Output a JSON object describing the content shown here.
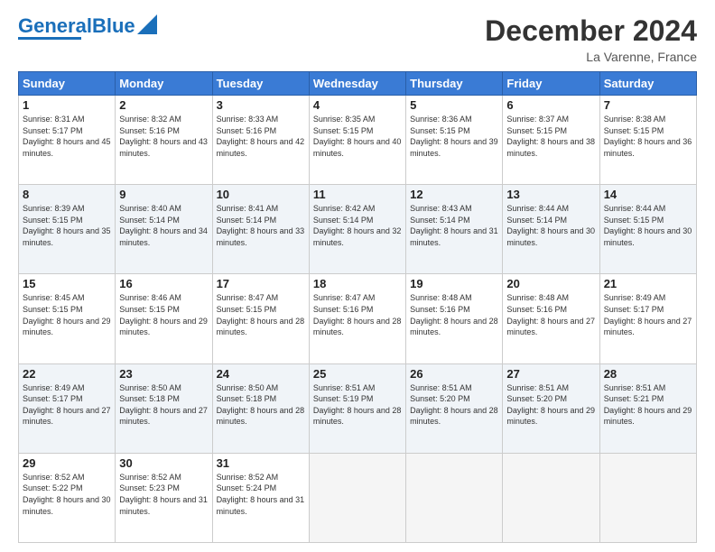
{
  "header": {
    "logo_text1": "General",
    "logo_text2": "Blue",
    "main_title": "December 2024",
    "subtitle": "La Varenne, France"
  },
  "calendar": {
    "days_of_week": [
      "Sunday",
      "Monday",
      "Tuesday",
      "Wednesday",
      "Thursday",
      "Friday",
      "Saturday"
    ],
    "weeks": [
      [
        {
          "day": "1",
          "sunrise": "8:31 AM",
          "sunset": "5:17 PM",
          "daylight": "8 hours and 45 minutes."
        },
        {
          "day": "2",
          "sunrise": "8:32 AM",
          "sunset": "5:16 PM",
          "daylight": "8 hours and 43 minutes."
        },
        {
          "day": "3",
          "sunrise": "8:33 AM",
          "sunset": "5:16 PM",
          "daylight": "8 hours and 42 minutes."
        },
        {
          "day": "4",
          "sunrise": "8:35 AM",
          "sunset": "5:15 PM",
          "daylight": "8 hours and 40 minutes."
        },
        {
          "day": "5",
          "sunrise": "8:36 AM",
          "sunset": "5:15 PM",
          "daylight": "8 hours and 39 minutes."
        },
        {
          "day": "6",
          "sunrise": "8:37 AM",
          "sunset": "5:15 PM",
          "daylight": "8 hours and 38 minutes."
        },
        {
          "day": "7",
          "sunrise": "8:38 AM",
          "sunset": "5:15 PM",
          "daylight": "8 hours and 36 minutes."
        }
      ],
      [
        {
          "day": "8",
          "sunrise": "8:39 AM",
          "sunset": "5:15 PM",
          "daylight": "8 hours and 35 minutes."
        },
        {
          "day": "9",
          "sunrise": "8:40 AM",
          "sunset": "5:14 PM",
          "daylight": "8 hours and 34 minutes."
        },
        {
          "day": "10",
          "sunrise": "8:41 AM",
          "sunset": "5:14 PM",
          "daylight": "8 hours and 33 minutes."
        },
        {
          "day": "11",
          "sunrise": "8:42 AM",
          "sunset": "5:14 PM",
          "daylight": "8 hours and 32 minutes."
        },
        {
          "day": "12",
          "sunrise": "8:43 AM",
          "sunset": "5:14 PM",
          "daylight": "8 hours and 31 minutes."
        },
        {
          "day": "13",
          "sunrise": "8:44 AM",
          "sunset": "5:14 PM",
          "daylight": "8 hours and 30 minutes."
        },
        {
          "day": "14",
          "sunrise": "8:44 AM",
          "sunset": "5:15 PM",
          "daylight": "8 hours and 30 minutes."
        }
      ],
      [
        {
          "day": "15",
          "sunrise": "8:45 AM",
          "sunset": "5:15 PM",
          "daylight": "8 hours and 29 minutes."
        },
        {
          "day": "16",
          "sunrise": "8:46 AM",
          "sunset": "5:15 PM",
          "daylight": "8 hours and 29 minutes."
        },
        {
          "day": "17",
          "sunrise": "8:47 AM",
          "sunset": "5:15 PM",
          "daylight": "8 hours and 28 minutes."
        },
        {
          "day": "18",
          "sunrise": "8:47 AM",
          "sunset": "5:16 PM",
          "daylight": "8 hours and 28 minutes."
        },
        {
          "day": "19",
          "sunrise": "8:48 AM",
          "sunset": "5:16 PM",
          "daylight": "8 hours and 28 minutes."
        },
        {
          "day": "20",
          "sunrise": "8:48 AM",
          "sunset": "5:16 PM",
          "daylight": "8 hours and 27 minutes."
        },
        {
          "day": "21",
          "sunrise": "8:49 AM",
          "sunset": "5:17 PM",
          "daylight": "8 hours and 27 minutes."
        }
      ],
      [
        {
          "day": "22",
          "sunrise": "8:49 AM",
          "sunset": "5:17 PM",
          "daylight": "8 hours and 27 minutes."
        },
        {
          "day": "23",
          "sunrise": "8:50 AM",
          "sunset": "5:18 PM",
          "daylight": "8 hours and 27 minutes."
        },
        {
          "day": "24",
          "sunrise": "8:50 AM",
          "sunset": "5:18 PM",
          "daylight": "8 hours and 28 minutes."
        },
        {
          "day": "25",
          "sunrise": "8:51 AM",
          "sunset": "5:19 PM",
          "daylight": "8 hours and 28 minutes."
        },
        {
          "day": "26",
          "sunrise": "8:51 AM",
          "sunset": "5:20 PM",
          "daylight": "8 hours and 28 minutes."
        },
        {
          "day": "27",
          "sunrise": "8:51 AM",
          "sunset": "5:20 PM",
          "daylight": "8 hours and 29 minutes."
        },
        {
          "day": "28",
          "sunrise": "8:51 AM",
          "sunset": "5:21 PM",
          "daylight": "8 hours and 29 minutes."
        }
      ],
      [
        {
          "day": "29",
          "sunrise": "8:52 AM",
          "sunset": "5:22 PM",
          "daylight": "8 hours and 30 minutes."
        },
        {
          "day": "30",
          "sunrise": "8:52 AM",
          "sunset": "5:23 PM",
          "daylight": "8 hours and 31 minutes."
        },
        {
          "day": "31",
          "sunrise": "8:52 AM",
          "sunset": "5:24 PM",
          "daylight": "8 hours and 31 minutes."
        },
        null,
        null,
        null,
        null
      ]
    ]
  }
}
